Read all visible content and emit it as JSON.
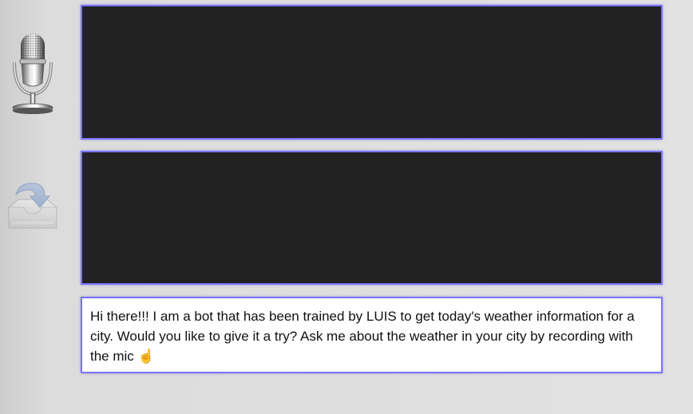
{
  "sidebar": {
    "mic_button": {
      "icon": "microphone-icon"
    },
    "send_button": {
      "icon": "tray-arrow-icon"
    }
  },
  "panels": {
    "transcript": {
      "text": ""
    },
    "response": {
      "text": ""
    },
    "bot_message": {
      "text": "Hi there!!! I am a bot that has been trained by LUIS to get today's weather information for a city. Would you like to give it a try? Ask me about the weather in your city by recording with the mic",
      "emoji": "☝"
    }
  },
  "colors": {
    "panel_border": "#7c74ff",
    "panel_dark": "#222222",
    "page_background": "#dcdcdc"
  }
}
